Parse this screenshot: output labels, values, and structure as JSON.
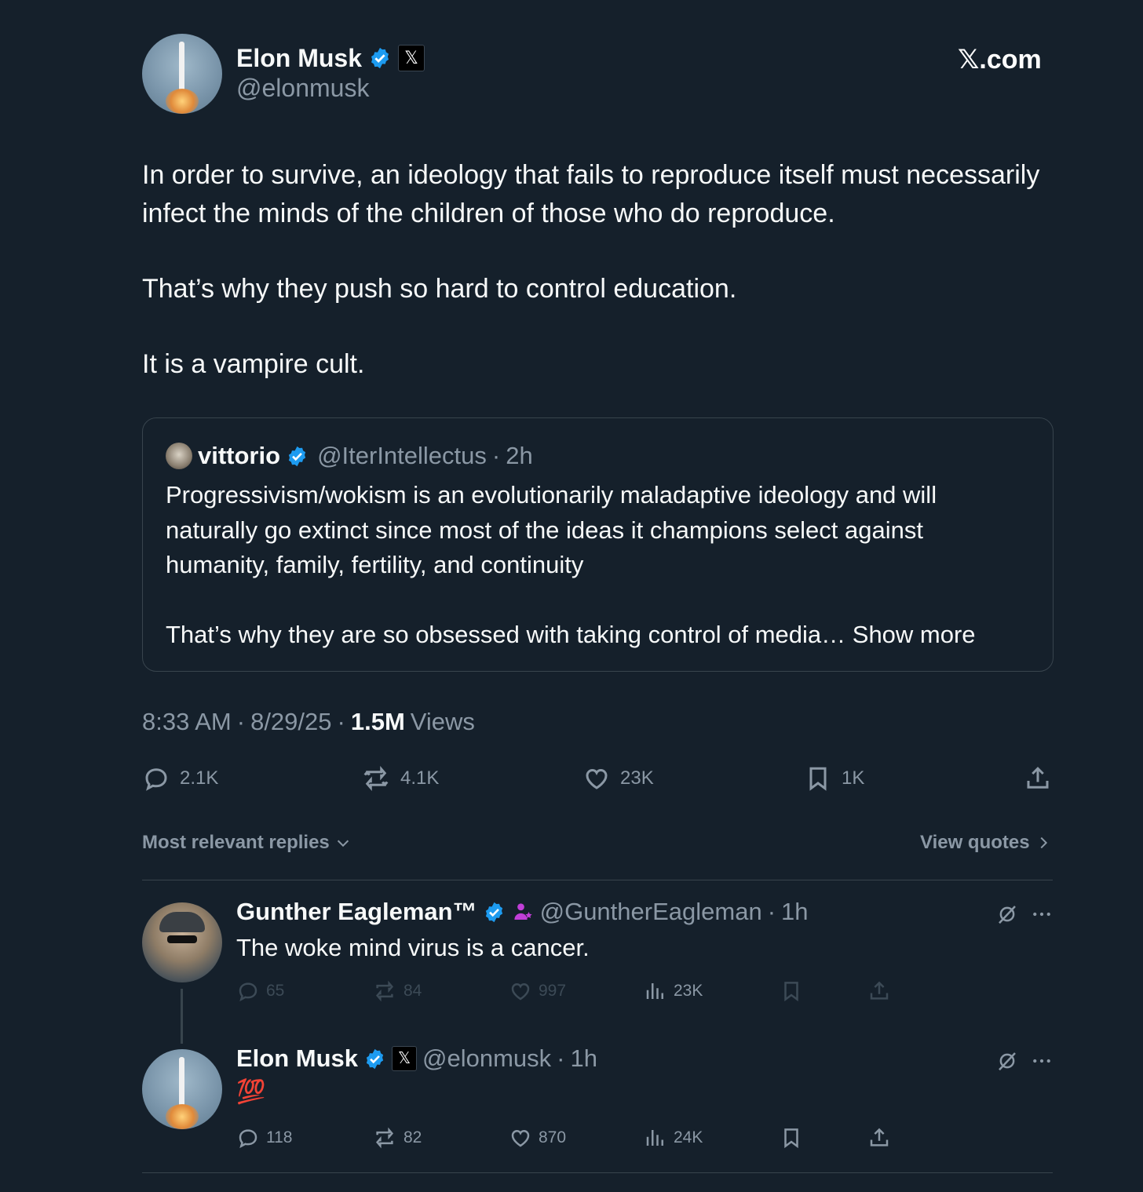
{
  "header": {
    "author_name": "Elon Musk",
    "author_handle": "@elonmusk",
    "brand": "𝕏.com",
    "x_badge": "𝕏"
  },
  "tweet": {
    "paragraphs": [
      "In order to survive, an ideology that fails to reproduce itself must necessarily infect the minds of the children of those who do reproduce.",
      "That’s why they push so hard to control education.",
      "It is a vampire cult."
    ]
  },
  "quote": {
    "name": "vittorio",
    "handle": "@IterIntellectus",
    "sep": "·",
    "time": "2h",
    "text_1": "Progressivism/wokism is an evolutionarily maladaptive ideology and will naturally go extinct since most of the ideas it champions select against humanity, family, fertility, and continuity",
    "text_2": "That’s why they are so obsessed with taking control of media…",
    "show_more": "Show more"
  },
  "meta": {
    "time": "8:33 AM",
    "sep": "·",
    "date": "8/29/25",
    "views_count": "1.5M",
    "views_label": "Views"
  },
  "actions": {
    "replies": "2.1K",
    "reposts": "4.1K",
    "likes": "23K",
    "bookmarks": "1K"
  },
  "reply_bar": {
    "sort_label": "Most relevant replies",
    "quotes_label": "View quotes"
  },
  "replies": [
    {
      "name": "Gunther Eagleman™",
      "handle": "@GuntherEagleman",
      "sep": "·",
      "time": "1h",
      "text": "The woke mind virus is a cancer.",
      "replies": "65",
      "reposts": "84",
      "likes": "997",
      "views": "23K"
    },
    {
      "name": "Elon Musk",
      "handle": "@elonmusk",
      "sep": "·",
      "time": "1h",
      "text": "💯",
      "replies": "118",
      "reposts": "82",
      "likes": "870",
      "views": "24K"
    }
  ],
  "icons": [
    "verified-icon",
    "x-badge-icon",
    "reply-icon",
    "repost-icon",
    "like-icon",
    "bookmark-icon",
    "share-icon",
    "views-icon",
    "grok-icon",
    "more-icon",
    "chevron-down-icon",
    "chevron-right-icon"
  ],
  "colors": {
    "background": "#15202b",
    "verified": "#1d9bf0",
    "muted": "#8b98a5"
  }
}
